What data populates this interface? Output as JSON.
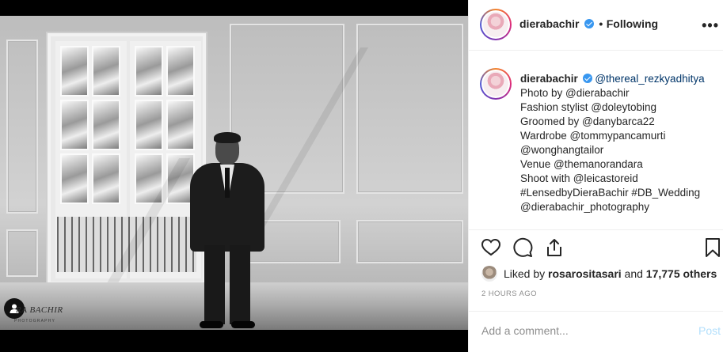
{
  "photo": {
    "watermark": "RA BACHIR",
    "watermark_sub": "PHOTOGRAPHY",
    "tag_icon": "person-tag-icon"
  },
  "header": {
    "username": "dierabachir",
    "separator": "•",
    "follow_status": "Following",
    "more_icon": "more-options-icon"
  },
  "caption": {
    "username": "dierabachir",
    "lines": [
      "@thereal_rezkyadhitya",
      "Photo by @dierabachir",
      "Fashion stylist @doleytobing",
      "Groomed by @danybarca22",
      "Wardrobe @tommypancamurti",
      "@wonghangtailor",
      "Venue @themanorandara",
      "Shoot with @leicastoreid",
      "#LensedbyDieraBachir #DB_Wedding",
      "@dierabachir_photography"
    ]
  },
  "actions": {
    "icons": [
      "heart-icon",
      "comment-icon",
      "share-icon",
      "bookmark-icon"
    ]
  },
  "likes": {
    "prefix": "Liked by",
    "liker": "rosarositasari",
    "connector": "and",
    "count": "17,775 others"
  },
  "timestamp": "2 HOURS AGO",
  "comment_box": {
    "placeholder": "Add a comment...",
    "post_label": "Post"
  },
  "colors": {
    "link": "#003569",
    "verified": "#3897f0",
    "post_disabled": "#b2dffc"
  }
}
